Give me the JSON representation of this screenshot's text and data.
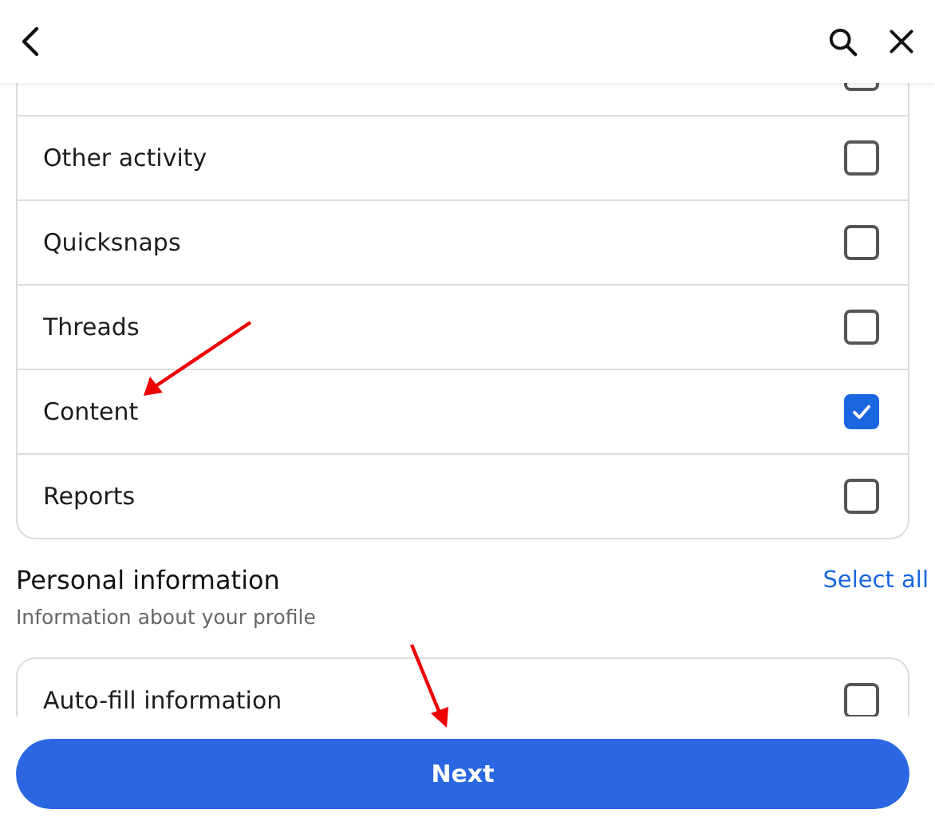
{
  "clipped_row": {
    "checked": false
  },
  "list": [
    {
      "label": "Other activity",
      "checked": false
    },
    {
      "label": "Quicksnaps",
      "checked": false
    },
    {
      "label": "Threads",
      "checked": false
    },
    {
      "label": "Content",
      "checked": true
    },
    {
      "label": "Reports",
      "checked": false
    }
  ],
  "section": {
    "title": "Personal information",
    "subtitle": "Information about your profile",
    "action": "Select all",
    "items": [
      {
        "label": "Auto-fill information",
        "checked": false
      }
    ]
  },
  "footer": {
    "button": "Next"
  }
}
